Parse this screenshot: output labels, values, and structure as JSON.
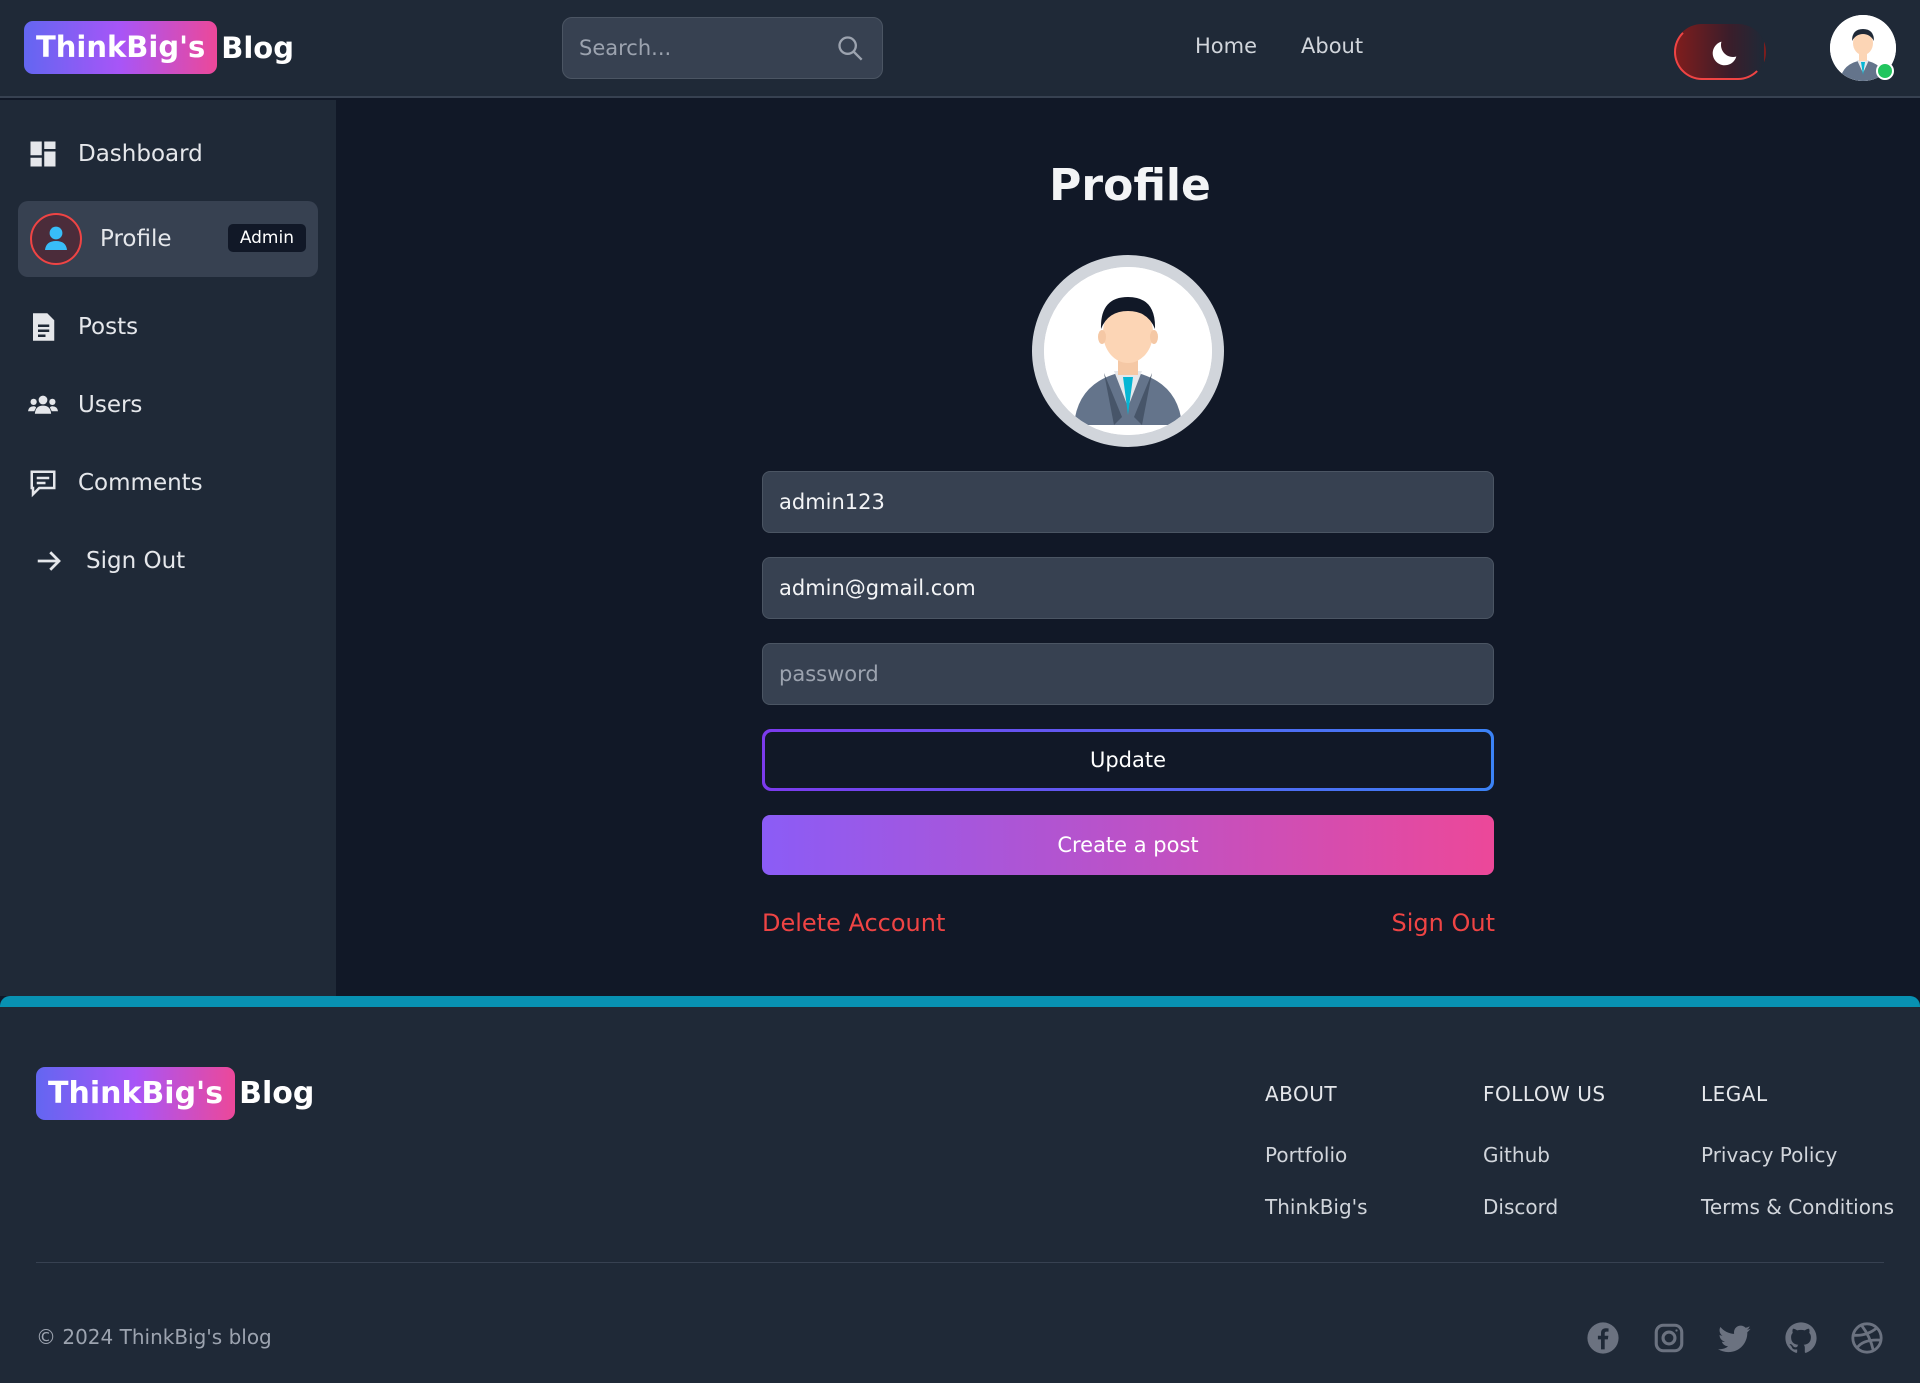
{
  "brand": {
    "badge": "ThinkBig's",
    "suffix": "Blog"
  },
  "header": {
    "search_placeholder": "Search...",
    "nav": {
      "home": "Home",
      "about": "About"
    }
  },
  "sidebar": {
    "items": [
      {
        "label": "Dashboard",
        "icon": "dashboard-icon"
      },
      {
        "label": "Profile",
        "icon": "user-icon",
        "badge": "Admin"
      },
      {
        "label": "Posts",
        "icon": "document-icon"
      },
      {
        "label": "Users",
        "icon": "users-icon"
      },
      {
        "label": "Comments",
        "icon": "comment-icon"
      },
      {
        "label": "Sign Out",
        "icon": "arrow-right-icon"
      }
    ]
  },
  "profile": {
    "title": "Profile",
    "username": "admin123",
    "email": "admin@gmail.com",
    "password_placeholder": "password",
    "update_label": "Update",
    "create_label": "Create a post",
    "delete_label": "Delete Account",
    "signout_label": "Sign Out"
  },
  "footer": {
    "columns": [
      {
        "heading": "ABOUT",
        "links": [
          "Portfolio",
          "ThinkBig's"
        ]
      },
      {
        "heading": "FOLLOW US",
        "links": [
          "Github",
          "Discord"
        ]
      },
      {
        "heading": "LEGAL",
        "links": [
          "Privacy Policy",
          "Terms & Conditions"
        ]
      }
    ],
    "copyright": "© 2024 ThinkBig's blog",
    "social": [
      "facebook-icon",
      "instagram-icon",
      "twitter-icon",
      "github-icon",
      "dribbble-icon"
    ]
  },
  "colors": {
    "background": "#111827",
    "panel": "#1f2937",
    "accent_gradient": [
      "#6366f1",
      "#ec4899"
    ],
    "danger": "#ef4444",
    "footer_border": "#0891b2",
    "online": "#22c55e"
  }
}
